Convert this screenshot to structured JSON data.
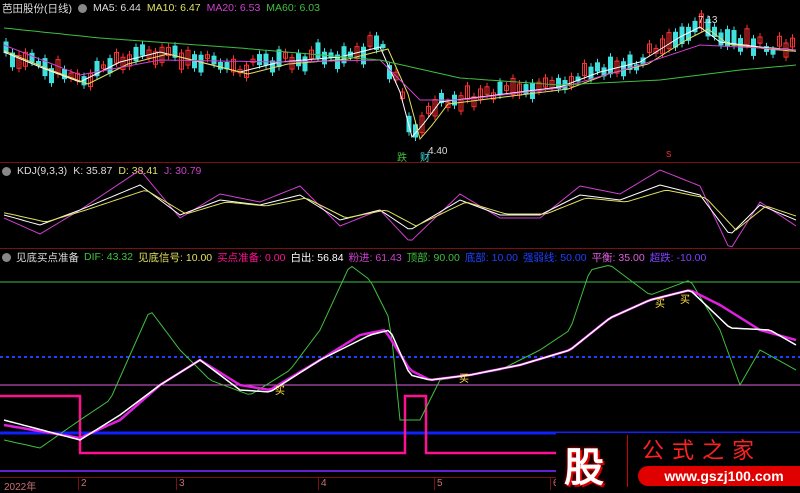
{
  "main": {
    "title": "芭田股份(日线)",
    "ma5": "MA5: 6.44",
    "ma10": "MA10: 6.47",
    "ma20": "MA20: 6.53",
    "ma60": "MA60: 6.03",
    "high_label": "7.13",
    "low_label": "4.40",
    "marker_fall": "跌",
    "marker_cai": "财",
    "marker_s": "S"
  },
  "kdj": {
    "title": "KDJ(9,3,3)",
    "k": "K: 35.87",
    "d": "D: 38.41",
    "j": "J: 30.79"
  },
  "ind": {
    "title": "见底买点准备",
    "dif": "DIF: 43.32",
    "jdxh": "见底信号: 10.00",
    "mdzb": "买点准备: 0.00",
    "bc": "白出: 56.84",
    "fj": "粉进: 61.43",
    "db": "顶部: 90.00",
    "bottom": "底部: 10.00",
    "qrx": "强弱线: 50.00",
    "ph": "平衡: 35.00",
    "cd": "超跌: -10.00",
    "buy": "买"
  },
  "axis": {
    "ticks": [
      "2022年",
      "2",
      "3",
      "4",
      "5",
      "6"
    ]
  },
  "watermark": {
    "char": "股",
    "name": "公式之家",
    "url": "www.gszj100.com"
  },
  "colors": {
    "up": "#ff3030",
    "down": "#40e0e0",
    "ma5": "#ffffff",
    "ma10": "#e0e060",
    "ma20": "#d040d0",
    "ma60": "#40c040"
  }
}
